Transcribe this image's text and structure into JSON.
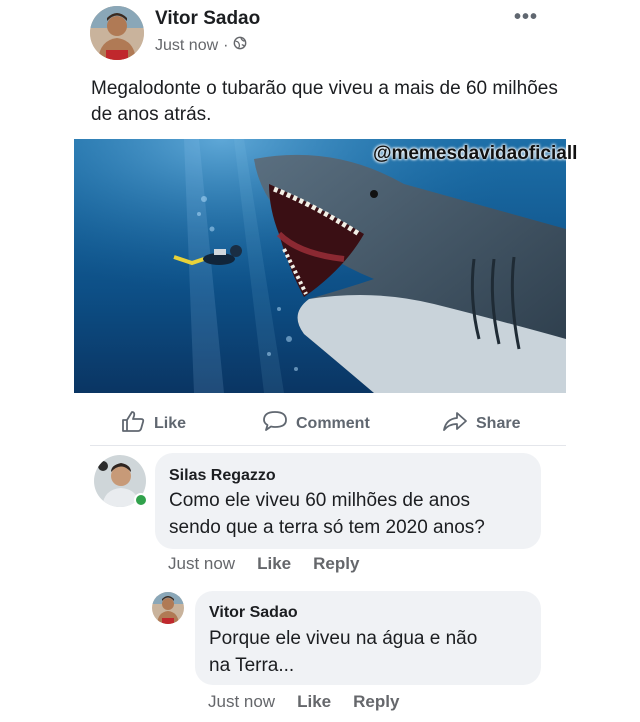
{
  "post": {
    "author": "Vitor Sadao",
    "time": "Just now",
    "separator": "·",
    "more_label": "•••",
    "text": "Megalodonte o tubarão que viveu a mais de 60 milhões de anos atrás.",
    "image_watermark": "@memesdavidaoficiall",
    "icons": {
      "globe": "globe-icon",
      "more": "more-options-icon"
    }
  },
  "actions": {
    "like_label": "Like",
    "comment_label": "Comment",
    "share_label": "Share"
  },
  "comments": [
    {
      "name": "Silas Regazzo",
      "text_line1": "Como ele viveu 60 milhões de anos",
      "text_line2": "sendo que a terra só tem 2020 anos?",
      "time": "Just now",
      "like_label": "Like",
      "reply_label": "Reply"
    }
  ],
  "replies": [
    {
      "name": "Vitor Sadao",
      "text_line1": "Porque ele viveu na água e não",
      "text_line2": "na Terra...",
      "time": "Just now",
      "like_label": "Like",
      "reply_label": "Reply"
    }
  ],
  "colors": {
    "accent_green": "#31a24c",
    "bubble": "#f0f2f5",
    "muted_text": "#65676b"
  }
}
